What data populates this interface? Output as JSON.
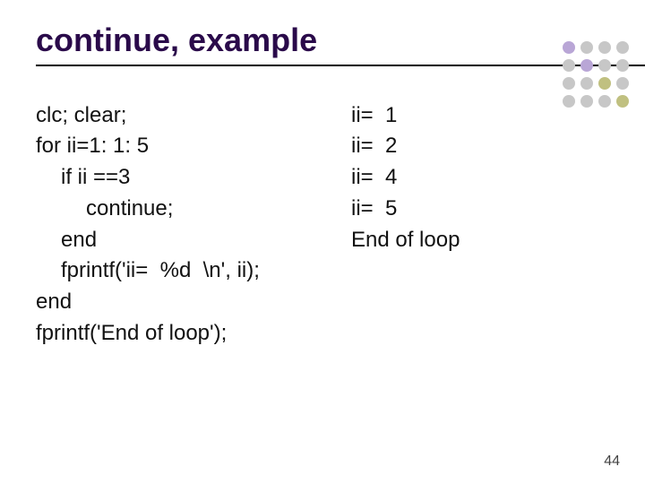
{
  "title": "continue, example",
  "code": {
    "l1": "clc; clear;",
    "l2": "for ii=1: 1: 5",
    "l3": "if ii ==3",
    "l4": "continue;",
    "l5": "end",
    "l6": "fprintf('ii=  %d  \\n', ii);",
    "l7": "end",
    "l8": "fprintf('End of loop');"
  },
  "output": {
    "o1": "ii=  1",
    "o2": "ii=  2",
    "o3": "ii=  4",
    "o4": "ii=  5",
    "o5": "End of loop"
  },
  "page_number": "44"
}
